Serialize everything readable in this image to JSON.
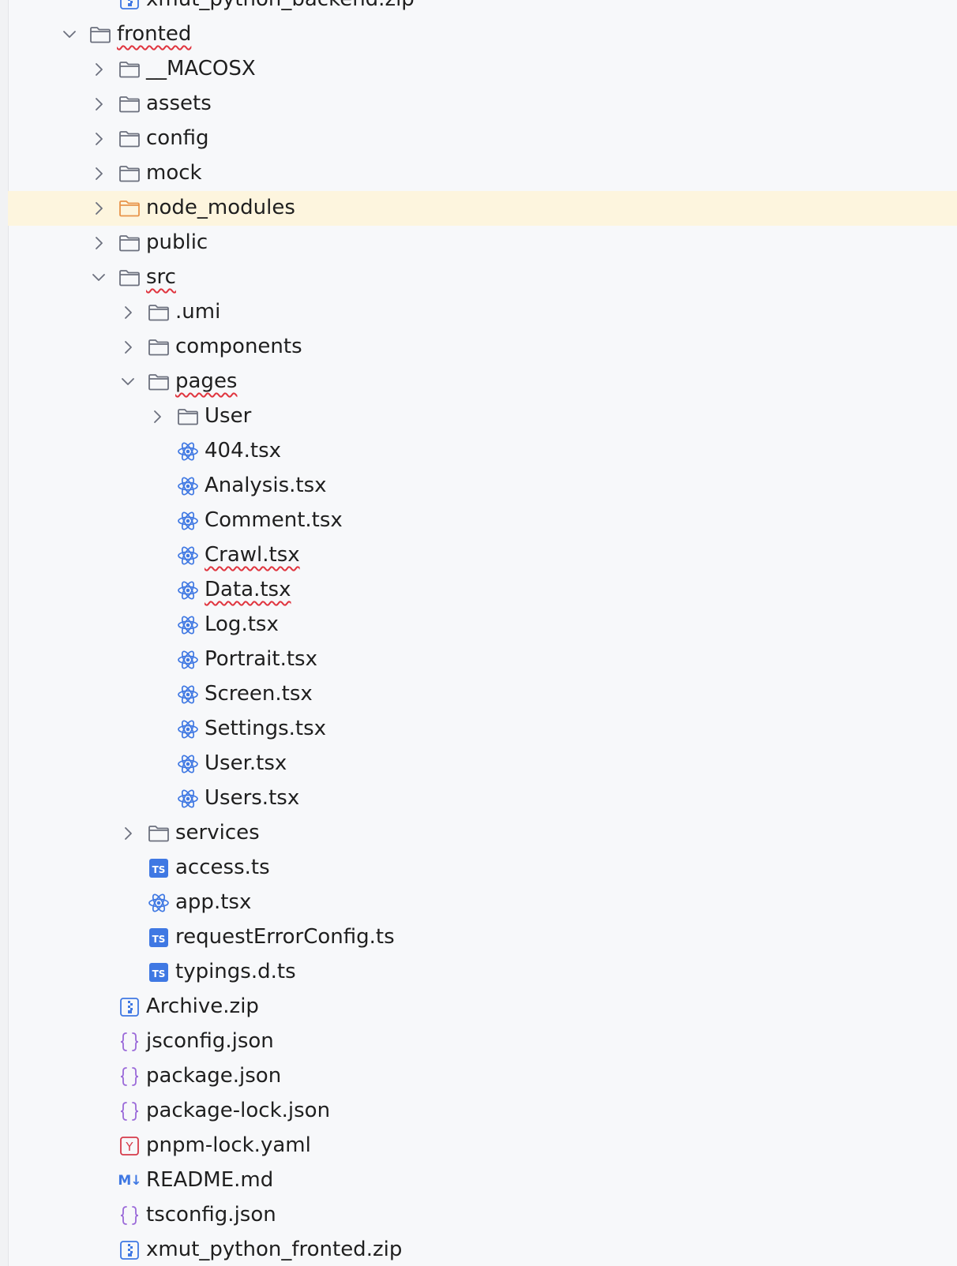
{
  "explorer": {
    "items": [
      {
        "label": "xmut_python_backend.zip",
        "depth": 1,
        "kind": "zip",
        "chevron": "none"
      },
      {
        "label": "fronted",
        "depth": 0,
        "kind": "folder",
        "chevron": "open",
        "squiggle": true
      },
      {
        "label": "__MACOSX",
        "depth": 1,
        "kind": "folder",
        "chevron": "closed"
      },
      {
        "label": "assets",
        "depth": 1,
        "kind": "folder",
        "chevron": "closed"
      },
      {
        "label": "config",
        "depth": 1,
        "kind": "folder",
        "chevron": "closed"
      },
      {
        "label": "mock",
        "depth": 1,
        "kind": "folder",
        "chevron": "closed"
      },
      {
        "label": "node_modules",
        "depth": 1,
        "kind": "folder-excluded",
        "chevron": "closed",
        "highlight": true
      },
      {
        "label": "public",
        "depth": 1,
        "kind": "folder",
        "chevron": "closed"
      },
      {
        "label": "src",
        "depth": 1,
        "kind": "folder",
        "chevron": "open",
        "squiggle": true
      },
      {
        "label": ".umi",
        "depth": 2,
        "kind": "folder",
        "chevron": "closed"
      },
      {
        "label": "components",
        "depth": 2,
        "kind": "folder",
        "chevron": "closed"
      },
      {
        "label": "pages",
        "depth": 2,
        "kind": "folder",
        "chevron": "open",
        "squiggle": true
      },
      {
        "label": "User",
        "depth": 3,
        "kind": "folder",
        "chevron": "closed"
      },
      {
        "label": "404.tsx",
        "depth": 3,
        "kind": "react",
        "chevron": "none"
      },
      {
        "label": "Analysis.tsx",
        "depth": 3,
        "kind": "react",
        "chevron": "none"
      },
      {
        "label": "Comment.tsx",
        "depth": 3,
        "kind": "react",
        "chevron": "none"
      },
      {
        "label": "Crawl.tsx",
        "depth": 3,
        "kind": "react",
        "chevron": "none",
        "squiggle": true
      },
      {
        "label": "Data.tsx",
        "depth": 3,
        "kind": "react",
        "chevron": "none",
        "squiggle": true
      },
      {
        "label": "Log.tsx",
        "depth": 3,
        "kind": "react",
        "chevron": "none"
      },
      {
        "label": "Portrait.tsx",
        "depth": 3,
        "kind": "react",
        "chevron": "none"
      },
      {
        "label": "Screen.tsx",
        "depth": 3,
        "kind": "react",
        "chevron": "none"
      },
      {
        "label": "Settings.tsx",
        "depth": 3,
        "kind": "react",
        "chevron": "none"
      },
      {
        "label": "User.tsx",
        "depth": 3,
        "kind": "react",
        "chevron": "none"
      },
      {
        "label": "Users.tsx",
        "depth": 3,
        "kind": "react",
        "chevron": "none"
      },
      {
        "label": "services",
        "depth": 2,
        "kind": "folder",
        "chevron": "closed"
      },
      {
        "label": "access.ts",
        "depth": 2,
        "kind": "ts",
        "chevron": "none"
      },
      {
        "label": "app.tsx",
        "depth": 2,
        "kind": "react",
        "chevron": "none"
      },
      {
        "label": "requestErrorConfig.ts",
        "depth": 2,
        "kind": "ts",
        "chevron": "none"
      },
      {
        "label": "typings.d.ts",
        "depth": 2,
        "kind": "ts",
        "chevron": "none"
      },
      {
        "label": "Archive.zip",
        "depth": 1,
        "kind": "zip",
        "chevron": "none"
      },
      {
        "label": "jsconfig.json",
        "depth": 1,
        "kind": "json",
        "chevron": "none"
      },
      {
        "label": "package.json",
        "depth": 1,
        "kind": "json",
        "chevron": "none"
      },
      {
        "label": "package-lock.json",
        "depth": 1,
        "kind": "json",
        "chevron": "none"
      },
      {
        "label": "pnpm-lock.yaml",
        "depth": 1,
        "kind": "yaml",
        "chevron": "none"
      },
      {
        "label": "README.md",
        "depth": 1,
        "kind": "markdown",
        "chevron": "none"
      },
      {
        "label": "tsconfig.json",
        "depth": 1,
        "kind": "json",
        "chevron": "none"
      },
      {
        "label": "xmut_python_fronted.zip",
        "depth": 1,
        "kind": "zip",
        "chevron": "none"
      }
    ]
  },
  "icons": {
    "folder": "folder-icon",
    "folder-excluded": "excluded-folder-icon",
    "react": "react-icon",
    "ts": "typescript-icon",
    "zip": "archive-icon",
    "json": "json-icon",
    "yaml": "yaml-icon",
    "markdown": "markdown-icon",
    "chevron_open": "chevron-down-icon",
    "chevron_closed": "chevron-right-icon"
  },
  "badges": {
    "ts": "TS",
    "yaml": "Y",
    "markdown": "M↓"
  },
  "colors": {
    "background": "#f7f8fa",
    "highlight_row": "#fdf5de",
    "folder_stroke": "#6c707e",
    "excluded_folder": "#e8944a",
    "react": "#3f78e3",
    "typescript": "#3f78e3",
    "json": "#9b6ad9",
    "yaml": "#d63b4a",
    "archive": "#3f78e3",
    "squiggle": "#e0353f"
  }
}
